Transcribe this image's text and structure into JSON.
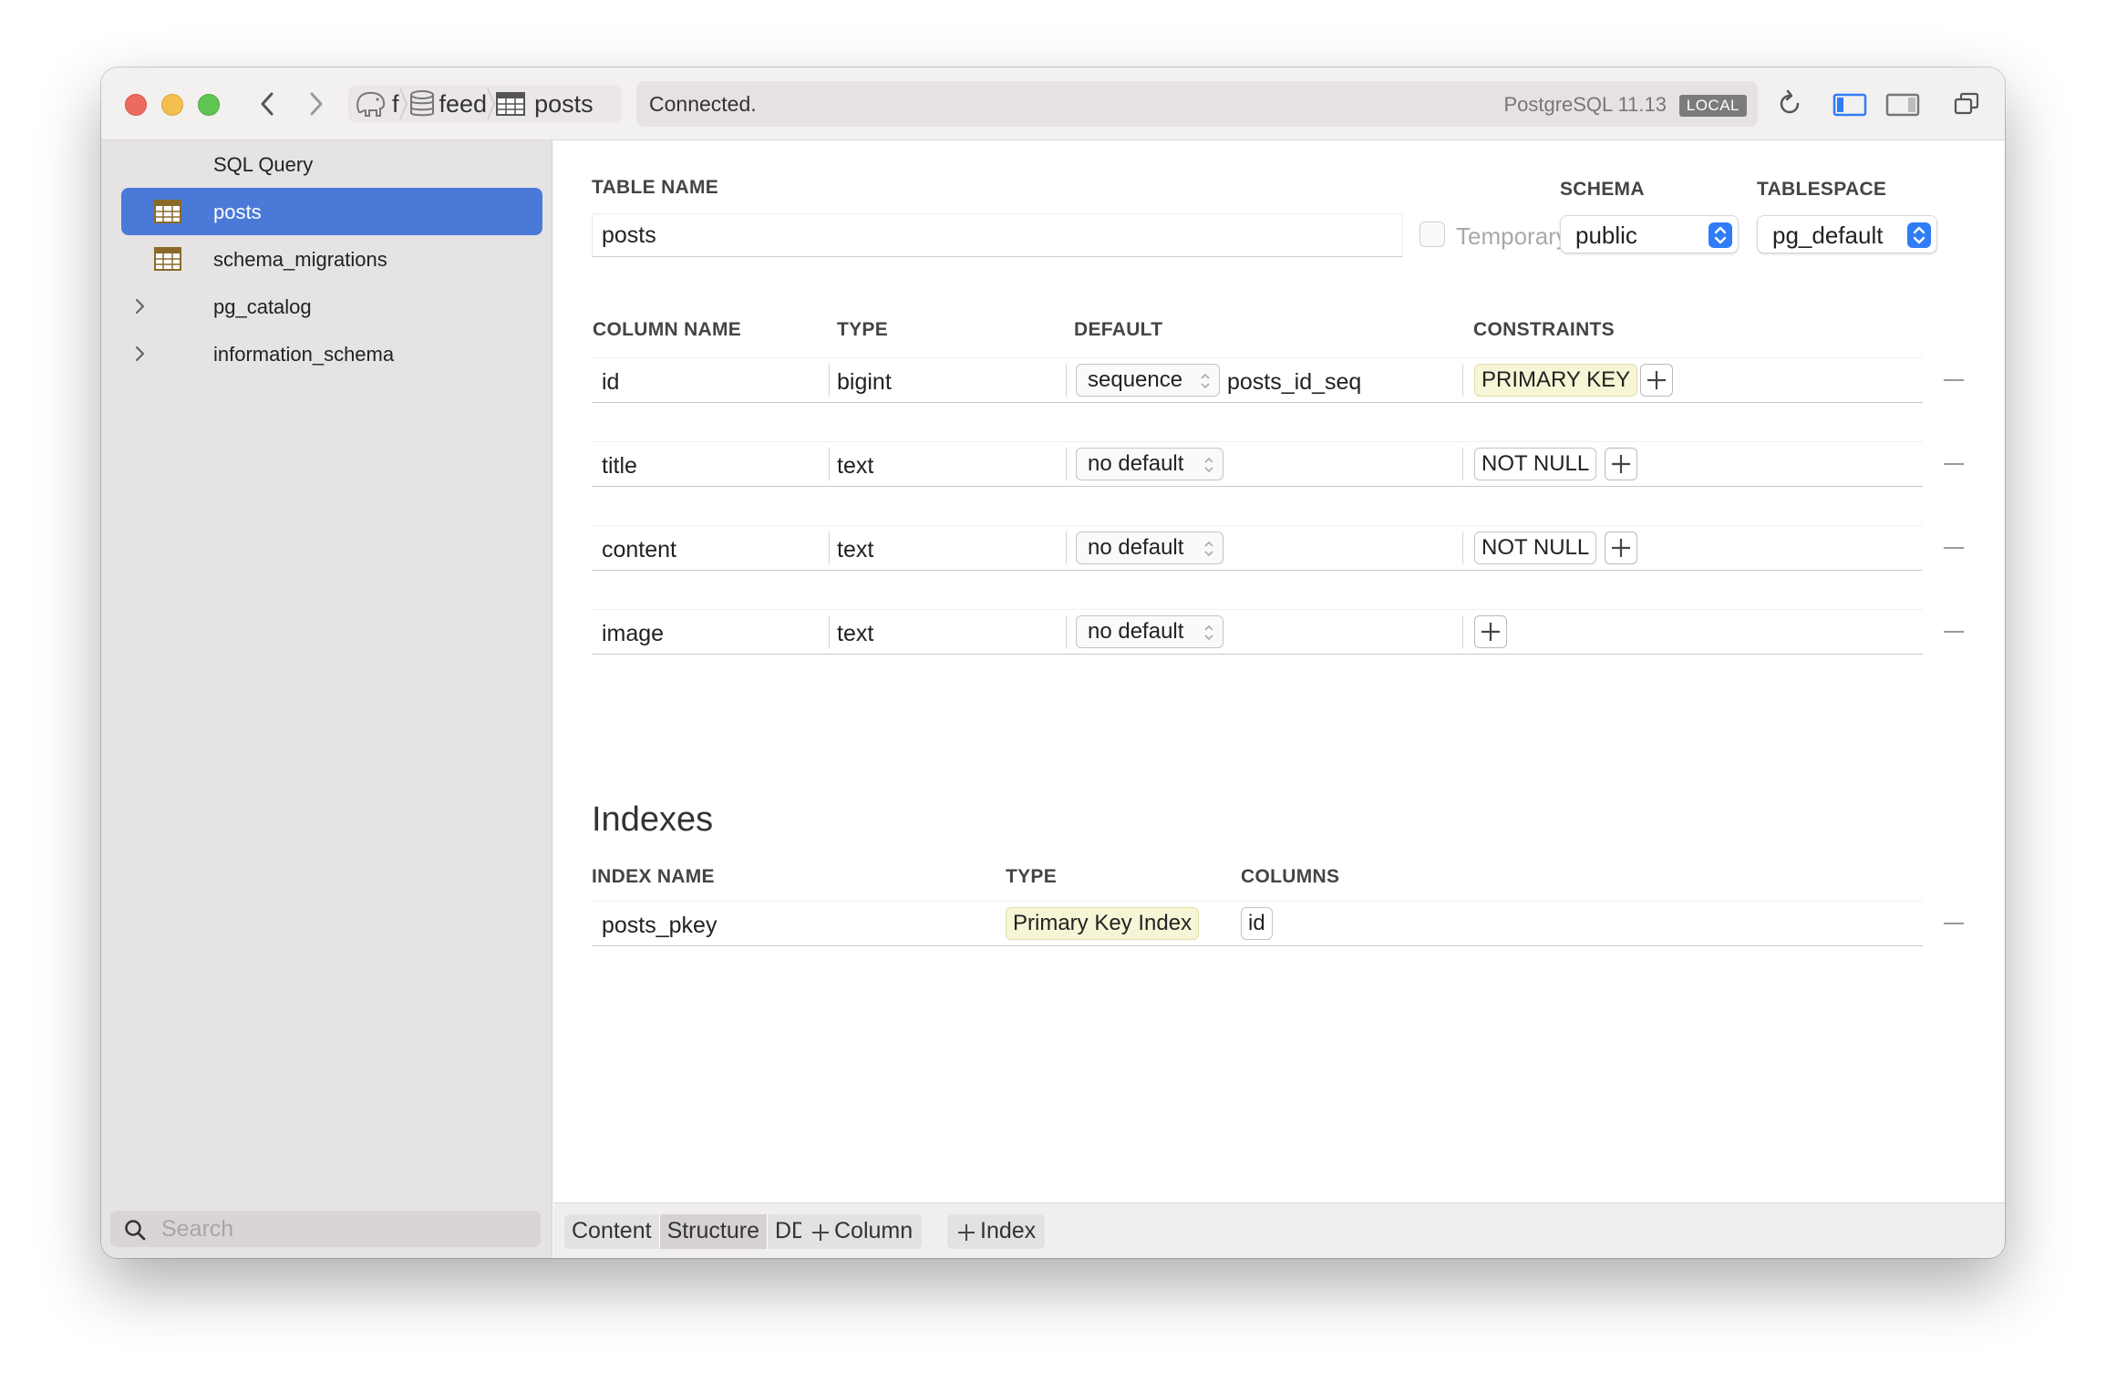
{
  "titlebar": {
    "breadcrumbs": [
      {
        "label": "f",
        "icon": "elephant-icon"
      },
      {
        "label": "feed",
        "icon": "database-icon"
      },
      {
        "label": "posts",
        "icon": "table-icon"
      }
    ],
    "status": "Connected.",
    "server_version": "PostgreSQL 11.13",
    "server_badge": "LOCAL"
  },
  "sidebar": {
    "items": [
      {
        "label": "SQL Query"
      },
      {
        "label": "posts",
        "selected": true
      },
      {
        "label": "schema_migrations"
      },
      {
        "label": "pg_catalog"
      },
      {
        "label": "information_schema"
      }
    ],
    "search_placeholder": "Search"
  },
  "table": {
    "name_label": "TABLE NAME",
    "name_value": "posts",
    "temporary_label": "Temporary",
    "temporary_checked": false,
    "schema_label": "SCHEMA",
    "schema_value": "public",
    "tablespace_label": "TABLESPACE",
    "tablespace_value": "pg_default"
  },
  "columns": {
    "headers": [
      "COLUMN NAME",
      "TYPE",
      "DEFAULT",
      "CONSTRAINTS"
    ],
    "rows": [
      {
        "name": "id",
        "type": "bigint",
        "default": "sequence",
        "default_value": "posts_id_seq",
        "constraint": "PRIMARY KEY"
      },
      {
        "name": "title",
        "type": "text",
        "default": "no default",
        "default_value": "",
        "constraint": "NOT NULL"
      },
      {
        "name": "content",
        "type": "text",
        "default": "no default",
        "default_value": "",
        "constraint": "NOT NULL"
      },
      {
        "name": "image",
        "type": "text",
        "default": "no default",
        "default_value": "",
        "constraint": ""
      }
    ]
  },
  "indexes": {
    "title": "Indexes",
    "headers": [
      "INDEX NAME",
      "TYPE",
      "COLUMNS"
    ],
    "rows": [
      {
        "name": "posts_pkey",
        "type": "Primary Key Index",
        "columns": "id"
      }
    ]
  },
  "bottombar": {
    "tabs": [
      "Content",
      "Structure",
      "DDL"
    ],
    "active_tab": "Structure",
    "add_column": "Column",
    "add_index": "Index"
  },
  "colors": {
    "selection": "#4a79d8",
    "accent": "#2f7cf6",
    "tag_yellow": "#f6f5d5"
  }
}
